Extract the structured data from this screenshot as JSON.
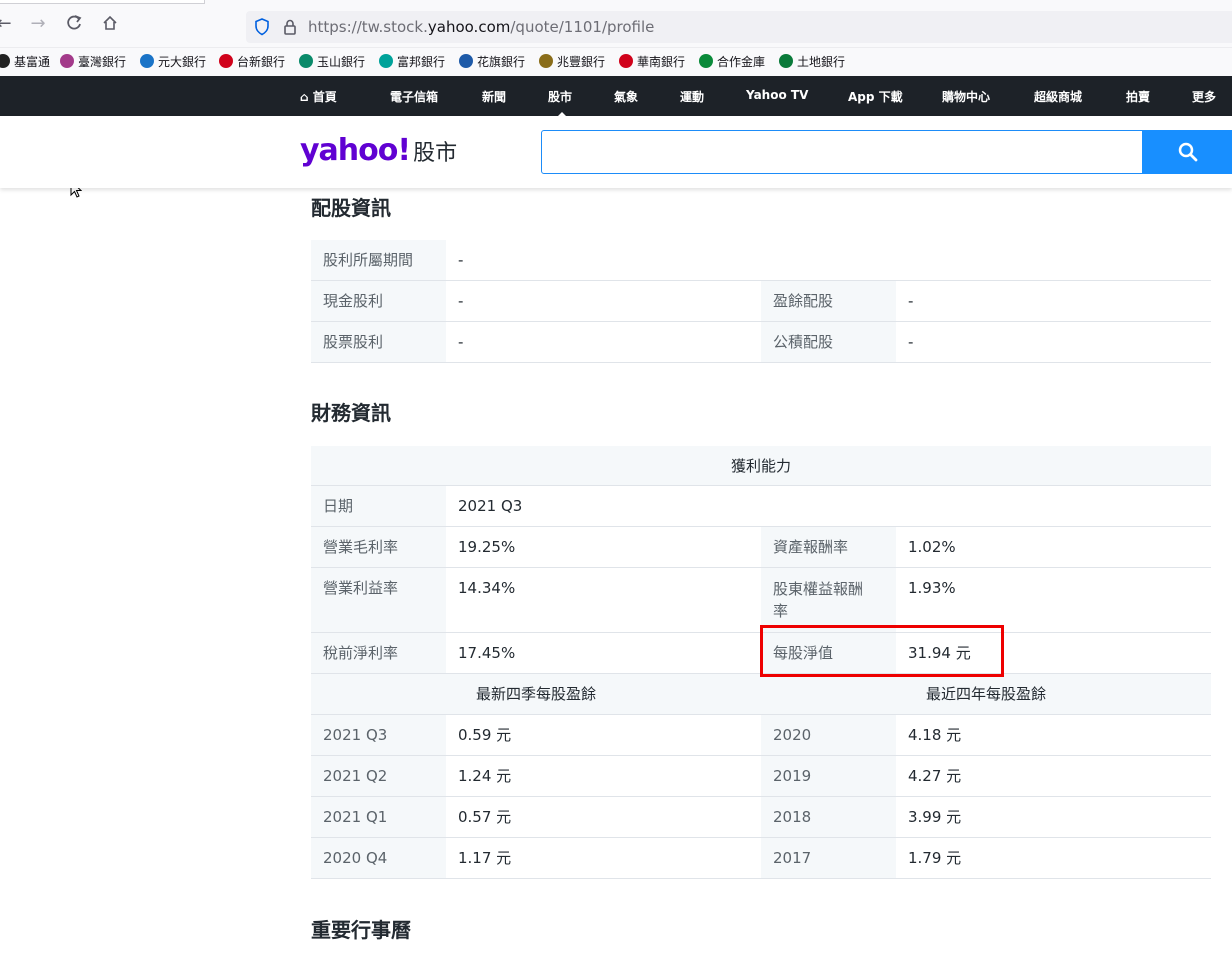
{
  "browser": {
    "url_prefix": "https://tw.stock.",
    "url_domain": "yahoo.com",
    "url_path": "/quote/1101/profile",
    "bookmarks": [
      "基富通",
      "臺灣銀行",
      "元大銀行",
      "台新銀行",
      "玉山銀行",
      "富邦銀行",
      "花旗銀行",
      "兆豐銀行",
      "華南銀行",
      "合作金庫",
      "土地銀行"
    ],
    "bookmark_colors": [
      "#222222",
      "#a33a8a",
      "#1a73c7",
      "#d0021b",
      "#0a8a6a",
      "#00a29a",
      "#1e5aa8",
      "#8a6d1a",
      "#d0021b",
      "#0a8a3a",
      "#0a7a3a"
    ]
  },
  "topnav": {
    "items": [
      "首頁",
      "電子信箱",
      "新聞",
      "股市",
      "氣象",
      "運動",
      "Yahoo TV",
      "App 下載",
      "購物中心",
      "超級商城",
      "拍賣",
      "更多"
    ],
    "active": "股市"
  },
  "header": {
    "logo": "yahoo!",
    "logo_sub": "股市",
    "search_value": ""
  },
  "dividend": {
    "title": "配股資訊",
    "period_label": "股利所屬期間",
    "period_value": "-",
    "cash_label": "現金股利",
    "cash_value": "-",
    "earnings_label": "盈餘配股",
    "earnings_value": "-",
    "stock_label": "股票股利",
    "stock_value": "-",
    "reserve_label": "公積配股",
    "reserve_value": "-"
  },
  "finance": {
    "title": "財務資訊",
    "profit_header": "獲利能力",
    "date_label": "日期",
    "date_value": "2021 Q3",
    "gross_label": "營業毛利率",
    "gross_value": "19.25%",
    "roa_label": "資產報酬率",
    "roa_value": "1.02%",
    "op_label": "營業利益率",
    "op_value": "14.34%",
    "roe_label_1": "股東權益報酬",
    "roe_label_2": "率",
    "roe_value": "1.93%",
    "pretax_label": "稅前淨利率",
    "pretax_value": "17.45%",
    "bvps_label": "每股淨值",
    "bvps_value": "31.94 元",
    "eps_quarter_header": "最新四季每股盈餘",
    "eps_year_header": "最近四年每股盈餘",
    "eps_rows": [
      {
        "q": "2021 Q3",
        "qv": "0.59 元",
        "y": "2020",
        "yv": "4.18 元"
      },
      {
        "q": "2021 Q2",
        "qv": "1.24 元",
        "y": "2019",
        "yv": "4.27 元"
      },
      {
        "q": "2021 Q1",
        "qv": "0.57 元",
        "y": "2018",
        "yv": "3.99 元"
      },
      {
        "q": "2020 Q4",
        "qv": "1.17 元",
        "y": "2017",
        "yv": "1.79 元"
      }
    ]
  },
  "calendar": {
    "title": "重要行事曆"
  }
}
